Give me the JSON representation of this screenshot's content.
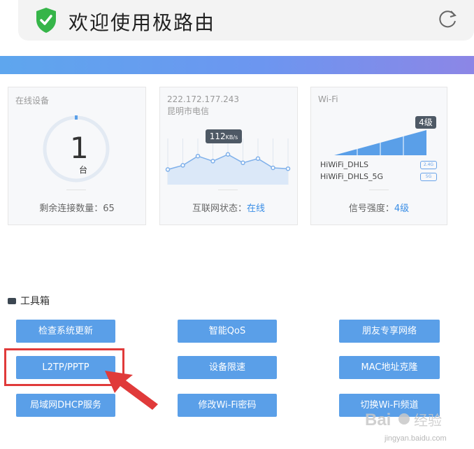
{
  "header": {
    "title": "欢迎使用极路由",
    "icon": "shield-check-icon",
    "refresh_icon": "refresh-icon"
  },
  "cards": {
    "devices": {
      "label": "在线设备",
      "count": "1",
      "unit": "台",
      "footer_label": "剩余连接数量：",
      "footer_value": "65"
    },
    "internet": {
      "ip": "222.172.177.243",
      "isp": "昆明市电信",
      "speed": "112",
      "speed_unit": "KB/s",
      "footer_label": "互联网状态：",
      "footer_value": "在线",
      "traffic_series": [
        0.36,
        0.46,
        0.68,
        0.56,
        0.72,
        0.52,
        0.62,
        0.4,
        0.38
      ]
    },
    "wifi": {
      "label": "Wi-Fi",
      "level": "4级",
      "ssid_24": "HiWiFi_DHLS",
      "band_24": "2.4G",
      "ssid_5": "HiWiFi_DHLS_5G",
      "band_5": "5G",
      "footer_label": "信号强度：",
      "footer_value": "4级",
      "signal_fraction": 0.8
    }
  },
  "toolbox": {
    "title": "工具箱",
    "buttons": [
      "检查系统更新",
      "智能QoS",
      "朋友专享网络",
      "L2TP/PPTP",
      "设备限速",
      "MAC地址克隆",
      "局域网DHCP服务",
      "修改Wi-Fi密码",
      "切换Wi-Fi频道"
    ]
  },
  "watermark": {
    "brand": "Bai",
    "brand2": "经验",
    "url": "jingyan.baidu.com"
  },
  "colors": {
    "accent": "#3a8ee6",
    "button": "#5a9fe8",
    "highlight": "#e03a3a",
    "shield": "#36b549"
  }
}
